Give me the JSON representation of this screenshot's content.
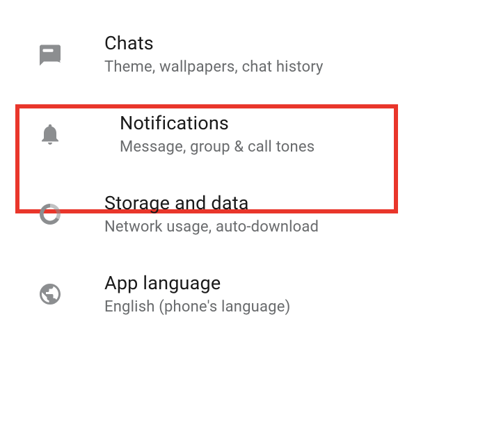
{
  "settings": {
    "items": [
      {
        "title": "Chats",
        "subtitle": "Theme, wallpapers, chat history"
      },
      {
        "title": "Notifications",
        "subtitle": "Message, group & call tones"
      },
      {
        "title": "Storage and data",
        "subtitle": "Network usage, auto-download"
      },
      {
        "title": "App language",
        "subtitle": "English (phone's language)"
      }
    ]
  }
}
